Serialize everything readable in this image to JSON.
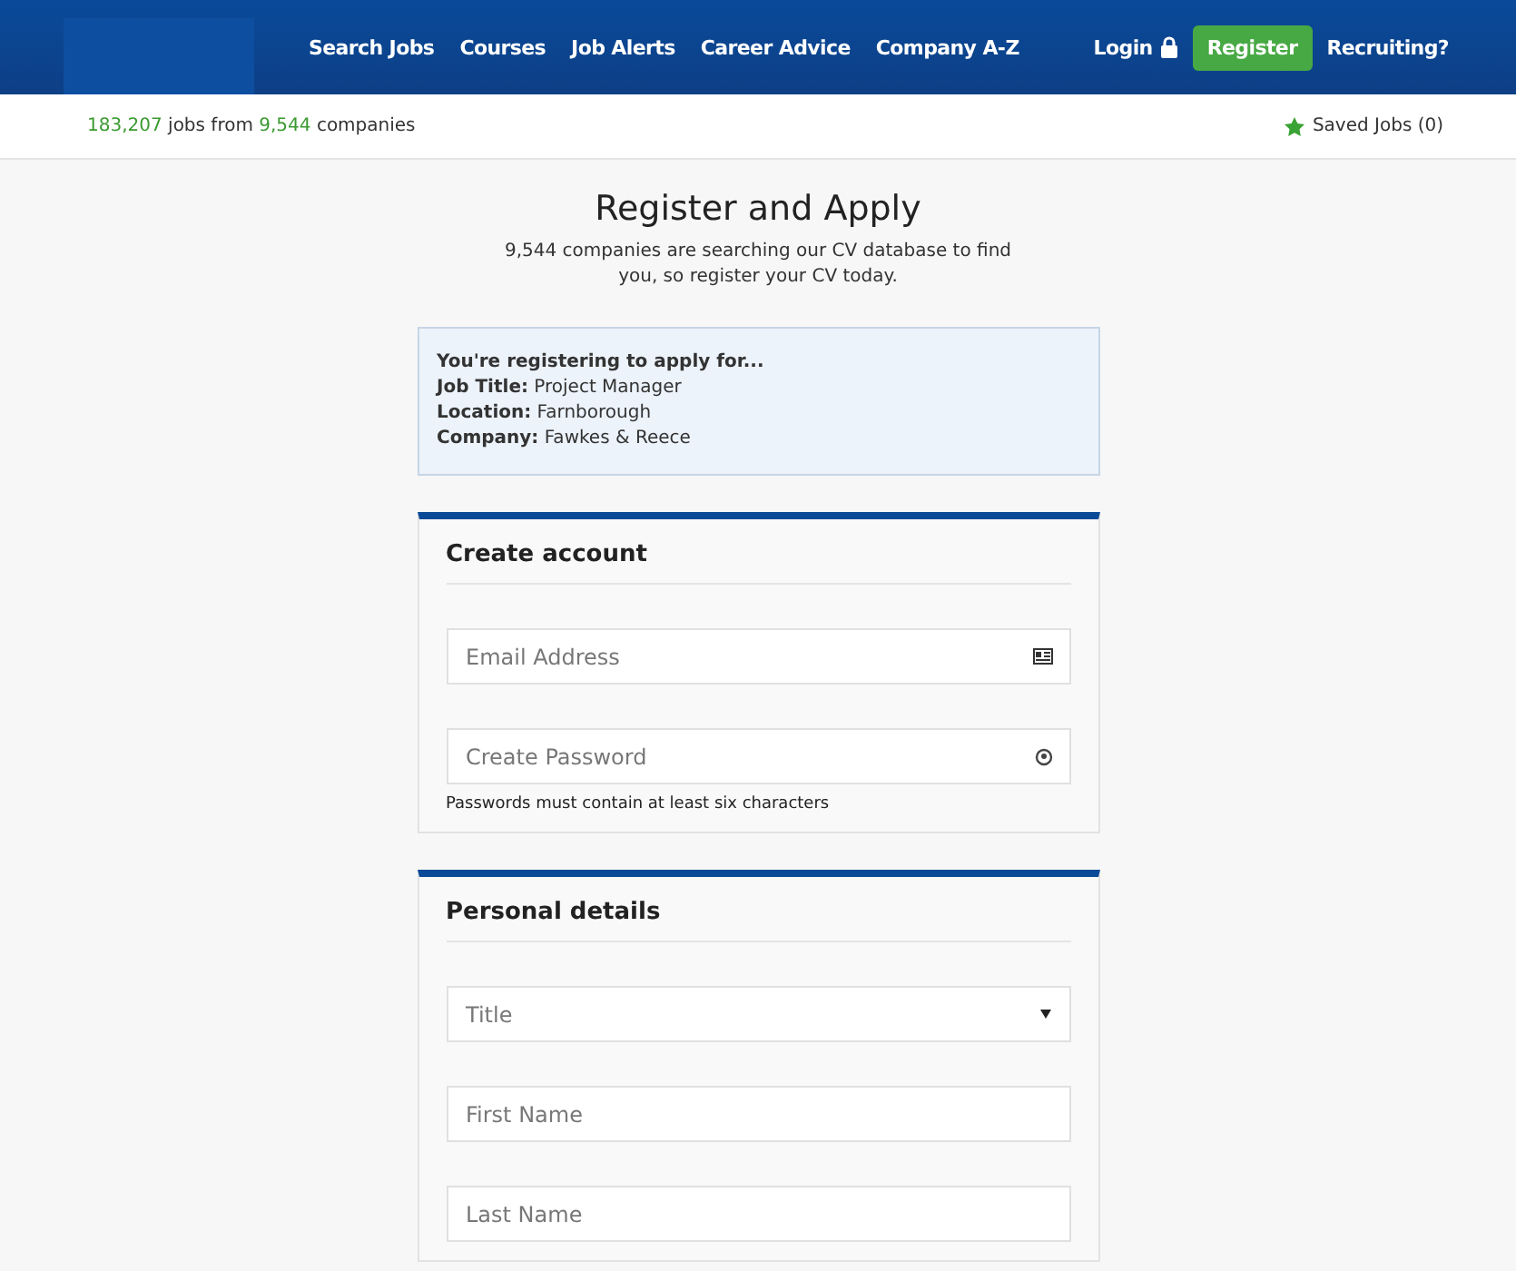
{
  "nav": {
    "links": [
      "Search Jobs",
      "Courses",
      "Job Alerts",
      "Career Advice",
      "Company A-Z"
    ],
    "login": "Login",
    "register": "Register",
    "recruiting": "Recruiting?"
  },
  "stats": {
    "jobs_count": "183,207",
    "jobs_label": "jobs from",
    "companies_count": "9,544",
    "companies_label": "companies",
    "saved_jobs": "Saved Jobs (0)"
  },
  "intro": {
    "title": "Register and Apply",
    "subtitle": "9,544 companies are searching our CV database to find you, so register your CV today."
  },
  "applying": {
    "heading": "You're registering to apply for...",
    "lines": [
      "**Job Title:** Project Manager",
      "**Location:** Farnborough",
      "**Company:** Fawkes & Reece"
    ]
  },
  "sections": [
    {
      "title": "Create account",
      "fields": [
        {
          "kind": "email",
          "placeholder": "Email Address"
        },
        {
          "kind": "password",
          "placeholder": "Create Password",
          "help": "Passwords must contain at least six characters"
        }
      ]
    },
    {
      "title": "Personal details",
      "fields": [
        {
          "kind": "select",
          "placeholder": "Title"
        },
        {
          "kind": "text",
          "placeholder": "First Name"
        },
        {
          "kind": "text",
          "placeholder": "Last Name"
        }
      ]
    }
  ]
}
